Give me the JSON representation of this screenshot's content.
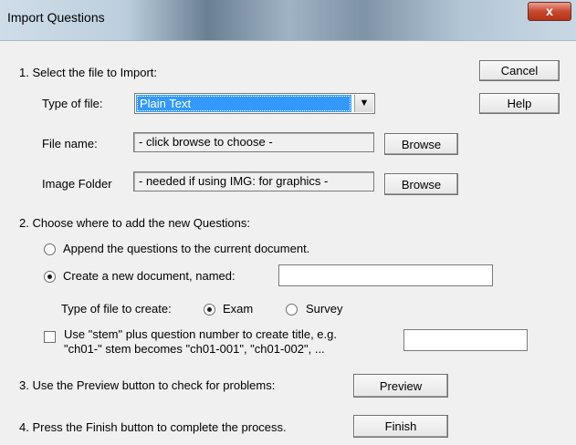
{
  "window": {
    "title": "Import Questions",
    "close_glyph": "x"
  },
  "buttons": {
    "cancel": "Cancel",
    "help": "Help",
    "browse_file": "Browse",
    "browse_image": "Browse",
    "preview": "Preview",
    "finish": "Finish"
  },
  "step1": {
    "heading": "1.  Select the file to Import:",
    "type_label": "Type of file:",
    "type_value": "Plain Text",
    "filename_label": "File name:",
    "filename_value": "- click browse to choose -",
    "image_label": "Image Folder",
    "image_value": "- needed if using IMG: for graphics -"
  },
  "step2": {
    "heading": "2.  Choose where to add the new Questions:",
    "append_label": "Append the questions to the current document.",
    "create_label": "Create a new document, named:",
    "create_value": "",
    "filetype_label": "Type of file to create:",
    "exam_label": "Exam",
    "survey_label": "Survey",
    "stem_line1": "Use \"stem\" plus question number to create title,  e.g.",
    "stem_line2": "\"ch01-\" stem becomes \"ch01-001\",  \"ch01-002\",  ...",
    "stem_value": ""
  },
  "step3": {
    "text": "3.  Use the Preview button to check for problems:"
  },
  "step4": {
    "text": "4.  Press the Finish button to complete the process."
  },
  "state": {
    "where": "create_new",
    "file_type": "exam",
    "use_stem": false
  }
}
